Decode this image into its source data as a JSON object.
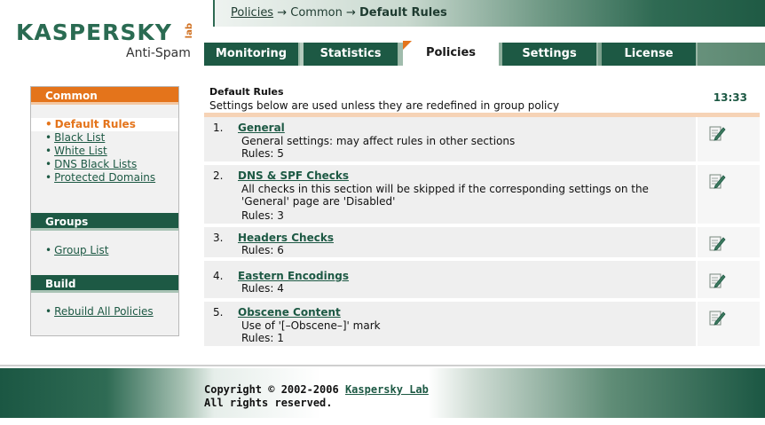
{
  "brand": {
    "logo_text": "KASPERSKY",
    "logo_lab": "lab",
    "product": "Anti-Spam"
  },
  "breadcrumb": {
    "part1": "Policies",
    "sep1": " → ",
    "part2": "Common",
    "sep2": " → ",
    "current": "Default Rules"
  },
  "tabs": [
    {
      "label": "Monitoring",
      "active": false
    },
    {
      "label": "Statistics",
      "active": false
    },
    {
      "label": "Policies",
      "active": true
    },
    {
      "label": "Settings",
      "active": false
    },
    {
      "label": "License",
      "active": false
    }
  ],
  "sidebar": {
    "common": {
      "title": "Common",
      "items": [
        {
          "label": "Default Rules",
          "current": true
        },
        {
          "label": "Black List",
          "current": false
        },
        {
          "label": "White List",
          "current": false
        },
        {
          "label": "DNS Black Lists",
          "current": false
        },
        {
          "label": "Protected Domains",
          "current": false
        }
      ]
    },
    "groups": {
      "title": "Groups",
      "items": [
        {
          "label": "Group List"
        }
      ]
    },
    "build": {
      "title": "Build",
      "items": [
        {
          "label": "Rebuild All Policies"
        }
      ]
    },
    "bullet": "•"
  },
  "main": {
    "title": "Default Rules",
    "description": "Settings below are used unless they are redefined in group policy",
    "time": "13:33",
    "rules": [
      {
        "num": "1.",
        "name": "General",
        "desc_lines": [
          "General settings: may affect rules in other sections"
        ],
        "count": "Rules: 5"
      },
      {
        "num": "2.",
        "name": "DNS & SPF Checks",
        "desc_lines": [
          "All checks in this section will be skipped if the corresponding settings on the",
          "'General' page are 'Disabled'"
        ],
        "count": "Rules: 3"
      },
      {
        "num": "3.",
        "name": "Headers Checks",
        "desc_lines": [],
        "count": "Rules: 6"
      },
      {
        "num": "4.",
        "name": "Eastern Encodings",
        "desc_lines": [],
        "count": "Rules: 4"
      },
      {
        "num": "5.",
        "name": "Obscene Content",
        "desc_lines": [
          "Use of '[–Obscene–]' mark"
        ],
        "count": "Rules: 1"
      }
    ]
  },
  "footer": {
    "copyright_prefix": "Copyright © 2002-2006 ",
    "company_link": "Kaspersky Lab",
    "rights": "All rights reserved."
  },
  "colors": {
    "brand_green": "#1d5944",
    "accent_orange": "#e4741b",
    "panel_gray": "#efefef"
  },
  "icons": {
    "edit": "edit-note-icon"
  }
}
